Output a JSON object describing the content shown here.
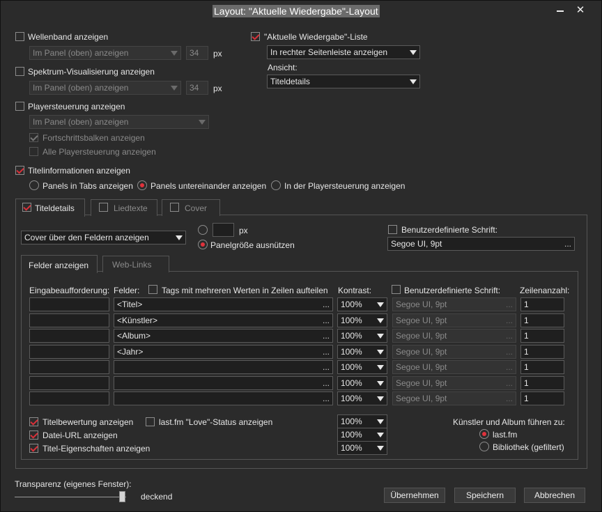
{
  "window": {
    "title": "Layout: \"Aktuelle Wiedergabe\"-Layout",
    "minimize_icon": "minimize-icon",
    "close_icon": "close-icon"
  },
  "waveform": {
    "label": "Wellenband anzeigen",
    "checked": false,
    "position": "Im Panel (oben) anzeigen",
    "size": "34",
    "unit": "px"
  },
  "spectrum": {
    "label": "Spektrum-Visualisierung anzeigen",
    "checked": false,
    "position": "Im Panel (oben) anzeigen",
    "size": "34",
    "unit": "px"
  },
  "player": {
    "label": "Playersteuerung anzeigen",
    "checked": false,
    "position": "Im Panel (oben) anzeigen",
    "progress_label": "Fortschrittsbalken anzeigen",
    "all_label": "Alle Playersteuerung anzeigen"
  },
  "now_playing_list": {
    "label": "\"Aktuelle Wiedergabe\"-Liste",
    "checked": true,
    "position": "In rechter Seitenleiste anzeigen",
    "view_label": "Ansicht:",
    "view_value": "Titeldetails"
  },
  "track_info": {
    "label": "Titelinformationen anzeigen",
    "checked": true,
    "radios": [
      "Panels in Tabs anzeigen",
      "Panels untereinander anzeigen",
      "In der Playersteuerung anzeigen"
    ],
    "selected": 1
  },
  "tabs": [
    {
      "label": "Titeldetails",
      "checked": true
    },
    {
      "label": "Liedtexte",
      "checked": false
    },
    {
      "label": "Cover",
      "checked": false
    }
  ],
  "details": {
    "cover_position": "Cover über den Feldern anzeigen",
    "px_unit": "px",
    "panel_size_label": "Panelgröße ausnützen",
    "custom_font_label": "Benutzerdefinierte Schrift:",
    "custom_font_value": "Segoe UI, 9pt",
    "subtabs": [
      "Felder anzeigen",
      "Web-Links"
    ],
    "headers": {
      "prompt": "Eingabeaufforderung:",
      "fields": "Felder:",
      "multi_values": "Tags mit mehreren Werten in Zeilen aufteilen",
      "contrast": "Kontrast:",
      "font": "Benutzerdefinierte Schrift:",
      "lines": "Zeilenanzahl:"
    },
    "rows": [
      {
        "field": "<Titel>",
        "contrast": "100%",
        "font": "Segoe UI, 9pt",
        "lines": "1"
      },
      {
        "field": "<Künstler>",
        "contrast": "100%",
        "font": "Segoe UI, 9pt",
        "lines": "1"
      },
      {
        "field": "<Album>",
        "contrast": "100%",
        "font": "Segoe UI, 9pt",
        "lines": "1"
      },
      {
        "field": "<Jahr>",
        "contrast": "100%",
        "font": "Segoe UI, 9pt",
        "lines": "1"
      },
      {
        "field": "",
        "contrast": "100%",
        "font": "Segoe UI, 9pt",
        "lines": "1"
      },
      {
        "field": "",
        "contrast": "100%",
        "font": "Segoe UI, 9pt",
        "lines": "1"
      },
      {
        "field": "",
        "contrast": "100%",
        "font": "Segoe UI, 9pt",
        "lines": "1"
      }
    ],
    "dots": "...",
    "rating_label": "Titelbewertung anzeigen",
    "love_label": "last.fm \"Love\"-Status anzeigen",
    "url_label": "Datei-URL anzeigen",
    "props_label": "Titel-Eigenschaften anzeigen",
    "bottom_contrast": [
      "100%",
      "100%",
      "100%"
    ],
    "link_heading": "Künstler und Album führen zu:",
    "link_options": [
      "last.fm",
      "Bibliothek (gefiltert)"
    ],
    "link_selected": 0
  },
  "transparency": {
    "label": "Transparenz (eigenes Fenster):",
    "value_label": "deckend",
    "level": 1.0
  },
  "buttons": {
    "apply": "Übernehmen",
    "save": "Speichern",
    "cancel": "Abbrechen"
  },
  "colors": {
    "accent": "#e0323c",
    "background": "#2b2b2b"
  }
}
